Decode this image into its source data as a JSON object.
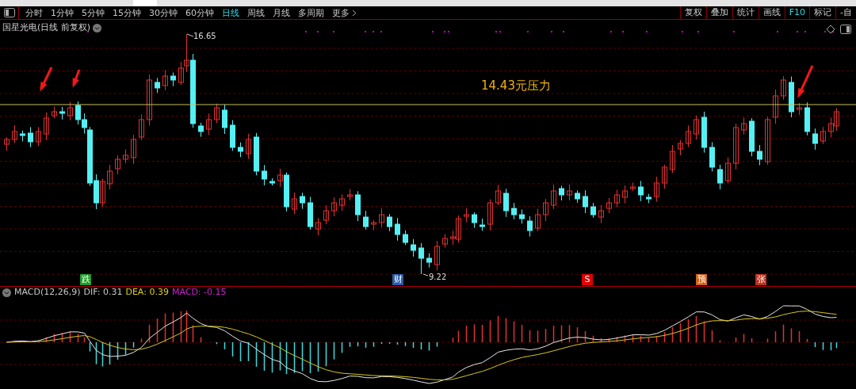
{
  "toolbar": {
    "periods": [
      {
        "label": "分时",
        "selected": false
      },
      {
        "label": "1分钟",
        "selected": false
      },
      {
        "label": "5分钟",
        "selected": false
      },
      {
        "label": "15分钟",
        "selected": false
      },
      {
        "label": "30分钟",
        "selected": false
      },
      {
        "label": "60分钟",
        "selected": false
      },
      {
        "label": "日线",
        "selected": true
      },
      {
        "label": "周线",
        "selected": false
      },
      {
        "label": "月线",
        "selected": false
      },
      {
        "label": "多周期",
        "selected": false
      },
      {
        "label": "更多",
        "selected": false
      }
    ],
    "tools": [
      {
        "label": "复权",
        "accent": false
      },
      {
        "label": "叠加",
        "accent": false
      },
      {
        "label": "统计",
        "accent": false
      },
      {
        "label": "画线",
        "accent": false
      },
      {
        "label": "F10",
        "accent": true
      },
      {
        "label": "标记",
        "accent": false
      },
      {
        "label": "-自",
        "accent": false
      }
    ]
  },
  "chart_title": "国星光电(日线 前复权)",
  "price_chart": {
    "high_label": "16.65",
    "low_label": "9.22",
    "annotation": "14.43元压力",
    "event_markers": [
      {
        "label": "跌",
        "color": "#1f9a2a"
      },
      {
        "label": "财",
        "color": "#2a5ca8"
      },
      {
        "label": "S",
        "color": "#e00000"
      },
      {
        "label": "预",
        "color": "#d0651a"
      },
      {
        "label": "张",
        "color": "#b8321e"
      }
    ]
  },
  "macd": {
    "name": "MACD(12,26,9)",
    "dif": "DIF: 0.31",
    "dea": "DEA: 0.39",
    "value": "MACD: -0.15"
  }
}
